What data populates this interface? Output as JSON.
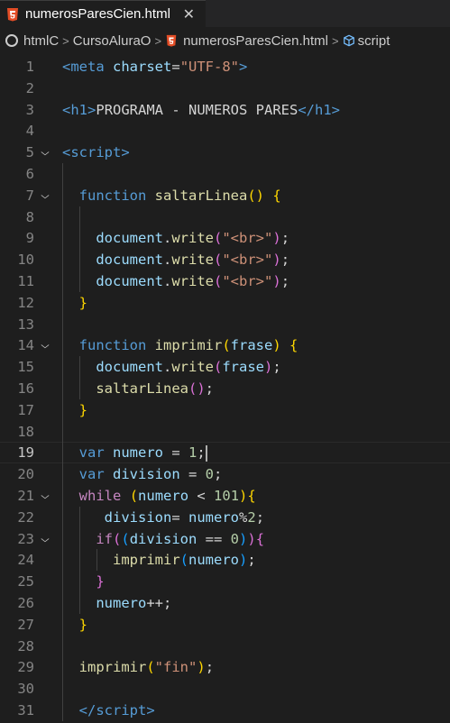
{
  "tab": {
    "title": "numerosParesCien.html",
    "close": "✕"
  },
  "breadcrumb": {
    "items": [
      "htmlC",
      "CursoAluraO",
      "numerosParesCien.html",
      "script"
    ]
  },
  "cursor_line": 19,
  "lines": [
    {
      "n": 1,
      "fold": "",
      "indent": 0,
      "tokens": [
        [
          "tag",
          "<"
        ],
        [
          "tag",
          "meta"
        ],
        [
          "text",
          " "
        ],
        [
          "attr",
          "charset"
        ],
        [
          "text",
          "="
        ],
        [
          "str",
          "\"UTF-8\""
        ],
        [
          "tag",
          ">"
        ]
      ]
    },
    {
      "n": 2,
      "fold": "",
      "indent": 0,
      "tokens": []
    },
    {
      "n": 3,
      "fold": "",
      "indent": 0,
      "tokens": [
        [
          "tag",
          "<"
        ],
        [
          "tag",
          "h1"
        ],
        [
          "tag",
          ">"
        ],
        [
          "text",
          "PROGRAMA - NUMEROS PARES"
        ],
        [
          "tag",
          "</"
        ],
        [
          "tag",
          "h1"
        ],
        [
          "tag",
          ">"
        ]
      ]
    },
    {
      "n": 4,
      "fold": "",
      "indent": 0,
      "tokens": []
    },
    {
      "n": 5,
      "fold": "v",
      "indent": 0,
      "tokens": [
        [
          "tag",
          "<"
        ],
        [
          "tag",
          "script"
        ],
        [
          "tag",
          ">"
        ]
      ]
    },
    {
      "n": 6,
      "fold": "",
      "indent": 0,
      "tokens": []
    },
    {
      "n": 7,
      "fold": "v",
      "indent": 1,
      "tokens": [
        [
          "kw",
          "function"
        ],
        [
          "text",
          " "
        ],
        [
          "fn",
          "saltarLinea"
        ],
        [
          "b1",
          "()"
        ],
        [
          "text",
          " "
        ],
        [
          "b1",
          "{"
        ]
      ]
    },
    {
      "n": 8,
      "fold": "",
      "indent": 0,
      "tokens": []
    },
    {
      "n": 9,
      "fold": "",
      "indent": 2,
      "tokens": [
        [
          "var",
          "document"
        ],
        [
          "text",
          "."
        ],
        [
          "fn",
          "write"
        ],
        [
          "b2",
          "("
        ],
        [
          "str",
          "\"<br>\""
        ],
        [
          "b2",
          ")"
        ],
        [
          "text",
          ";"
        ]
      ]
    },
    {
      "n": 10,
      "fold": "",
      "indent": 2,
      "tokens": [
        [
          "var",
          "document"
        ],
        [
          "text",
          "."
        ],
        [
          "fn",
          "write"
        ],
        [
          "b2",
          "("
        ],
        [
          "str",
          "\"<br>\""
        ],
        [
          "b2",
          ")"
        ],
        [
          "text",
          ";"
        ]
      ]
    },
    {
      "n": 11,
      "fold": "",
      "indent": 2,
      "tokens": [
        [
          "var",
          "document"
        ],
        [
          "text",
          "."
        ],
        [
          "fn",
          "write"
        ],
        [
          "b2",
          "("
        ],
        [
          "str",
          "\"<br>\""
        ],
        [
          "b2",
          ")"
        ],
        [
          "text",
          ";"
        ]
      ]
    },
    {
      "n": 12,
      "fold": "",
      "indent": 1,
      "tokens": [
        [
          "b1",
          "}"
        ]
      ]
    },
    {
      "n": 13,
      "fold": "",
      "indent": 0,
      "tokens": []
    },
    {
      "n": 14,
      "fold": "v",
      "indent": 1,
      "tokens": [
        [
          "kw",
          "function"
        ],
        [
          "text",
          " "
        ],
        [
          "fn",
          "imprimir"
        ],
        [
          "b1",
          "("
        ],
        [
          "var",
          "frase"
        ],
        [
          "b1",
          ")"
        ],
        [
          "text",
          " "
        ],
        [
          "b1",
          "{"
        ]
      ]
    },
    {
      "n": 15,
      "fold": "",
      "indent": 2,
      "tokens": [
        [
          "var",
          "document"
        ],
        [
          "text",
          "."
        ],
        [
          "fn",
          "write"
        ],
        [
          "b2",
          "("
        ],
        [
          "var",
          "frase"
        ],
        [
          "b2",
          ")"
        ],
        [
          "text",
          ";"
        ]
      ]
    },
    {
      "n": 16,
      "fold": "",
      "indent": 2,
      "tokens": [
        [
          "fn",
          "saltarLinea"
        ],
        [
          "b2",
          "()"
        ],
        [
          "text",
          ";"
        ]
      ]
    },
    {
      "n": 17,
      "fold": "",
      "indent": 1,
      "tokens": [
        [
          "b1",
          "}"
        ]
      ]
    },
    {
      "n": 18,
      "fold": "",
      "indent": 0,
      "tokens": []
    },
    {
      "n": 19,
      "fold": "",
      "indent": 1,
      "tokens": [
        [
          "kw",
          "var"
        ],
        [
          "text",
          " "
        ],
        [
          "var",
          "numero"
        ],
        [
          "text",
          " = "
        ],
        [
          "num",
          "1"
        ],
        [
          "text",
          ";"
        ]
      ]
    },
    {
      "n": 20,
      "fold": "",
      "indent": 1,
      "tokens": [
        [
          "kw",
          "var"
        ],
        [
          "text",
          " "
        ],
        [
          "var",
          "division"
        ],
        [
          "text",
          " = "
        ],
        [
          "num",
          "0"
        ],
        [
          "text",
          ";"
        ]
      ]
    },
    {
      "n": 21,
      "fold": "v",
      "indent": 1,
      "tokens": [
        [
          "ctl",
          "while"
        ],
        [
          "text",
          " "
        ],
        [
          "b1",
          "("
        ],
        [
          "var",
          "numero"
        ],
        [
          "text",
          " < "
        ],
        [
          "num",
          "101"
        ],
        [
          "b1",
          ")"
        ],
        [
          "b1",
          "{"
        ]
      ]
    },
    {
      "n": 22,
      "fold": "",
      "indent": 2,
      "extra": 1,
      "tokens": [
        [
          "var",
          "division"
        ],
        [
          "text",
          "= "
        ],
        [
          "var",
          "numero"
        ],
        [
          "text",
          "%"
        ],
        [
          "num",
          "2"
        ],
        [
          "text",
          ";"
        ]
      ]
    },
    {
      "n": 23,
      "fold": "v",
      "indent": 2,
      "tokens": [
        [
          "ctl",
          "if"
        ],
        [
          "b2",
          "("
        ],
        [
          "b3",
          "("
        ],
        [
          "var",
          "division"
        ],
        [
          "text",
          " == "
        ],
        [
          "num",
          "0"
        ],
        [
          "b3",
          ")"
        ],
        [
          "b2",
          ")"
        ],
        [
          "b2",
          "{"
        ]
      ]
    },
    {
      "n": 24,
      "fold": "",
      "indent": 3,
      "tokens": [
        [
          "fn",
          "imprimir"
        ],
        [
          "b3",
          "("
        ],
        [
          "var",
          "numero"
        ],
        [
          "b3",
          ")"
        ],
        [
          "text",
          ";"
        ]
      ]
    },
    {
      "n": 25,
      "fold": "",
      "indent": 2,
      "tokens": [
        [
          "b2",
          "}"
        ]
      ]
    },
    {
      "n": 26,
      "fold": "",
      "indent": 2,
      "tokens": [
        [
          "var",
          "numero"
        ],
        [
          "text",
          "++;"
        ]
      ]
    },
    {
      "n": 27,
      "fold": "",
      "indent": 1,
      "tokens": [
        [
          "b1",
          "}"
        ]
      ]
    },
    {
      "n": 28,
      "fold": "",
      "indent": 0,
      "tokens": []
    },
    {
      "n": 29,
      "fold": "",
      "indent": 1,
      "tokens": [
        [
          "fn",
          "imprimir"
        ],
        [
          "b1",
          "("
        ],
        [
          "str",
          "\"fin\""
        ],
        [
          "b1",
          ")"
        ],
        [
          "text",
          ";"
        ]
      ]
    },
    {
      "n": 30,
      "fold": "",
      "indent": 0,
      "tokens": []
    },
    {
      "n": 31,
      "fold": "",
      "indent": 1,
      "tokens": [
        [
          "tag",
          "</"
        ],
        [
          "tag",
          "script"
        ],
        [
          "tag",
          ">"
        ]
      ]
    }
  ]
}
